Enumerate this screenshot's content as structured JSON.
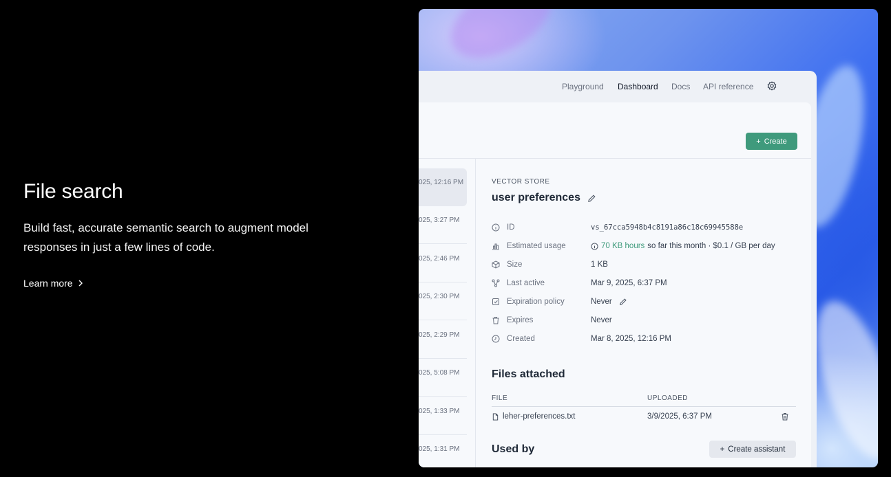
{
  "hero": {
    "title": "File search",
    "description": "Build fast, accurate semantic search to augment model responses in just a few lines of code.",
    "link": "Learn more"
  },
  "nav": {
    "items": [
      {
        "label": "Playground",
        "active": false
      },
      {
        "label": "Dashboard",
        "active": true
      },
      {
        "label": "Docs",
        "active": false
      },
      {
        "label": "API reference",
        "active": false
      }
    ],
    "settings_icon": "gear-icon"
  },
  "toolbar": {
    "create_label": "Create"
  },
  "list": {
    "items": [
      "025, 12:16 PM",
      "025, 3:27 PM",
      "025, 2:46 PM",
      "025, 2:30 PM",
      "025, 2:29 PM",
      "025, 5:08 PM",
      "025, 1:33 PM",
      "025, 1:31 PM"
    ]
  },
  "detail": {
    "eyebrow": "VECTOR STORE",
    "name": "user preferences",
    "props": {
      "id": {
        "label": "ID",
        "value": "vs_67cca5948b4c8191a86c18c69945588e"
      },
      "usage": {
        "label": "Estimated usage",
        "highlight": "70 KB hours",
        "rest": "so far this month · $0.1 / GB per day"
      },
      "size": {
        "label": "Size",
        "value": "1 KB"
      },
      "last_active": {
        "label": "Last active",
        "value": "Mar 9, 2025, 6:37 PM"
      },
      "expiration": {
        "label": "Expiration policy",
        "value": "Never"
      },
      "expires": {
        "label": "Expires",
        "value": "Never"
      },
      "created": {
        "label": "Created",
        "value": "Mar 8, 2025, 12:16 PM"
      }
    },
    "files": {
      "title": "Files attached",
      "col_file": "FILE",
      "col_uploaded": "UPLOADED",
      "rows": [
        {
          "name": "leher-preferences.txt",
          "uploaded": "3/9/2025, 6:37 PM"
        }
      ]
    },
    "used_by": {
      "title": "Used by",
      "button": "Create assistant"
    }
  },
  "colors": {
    "accent": "#3f9a7c",
    "background": "#000000"
  }
}
